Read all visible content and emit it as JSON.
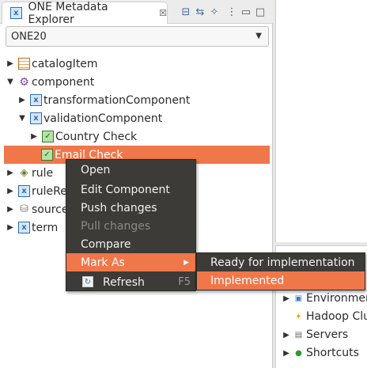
{
  "view": {
    "title": "ONE Metadata Explorer",
    "close_symbol": "☒"
  },
  "combo": {
    "value": "ONE20"
  },
  "tree": {
    "items": [
      {
        "label": "catalogItem"
      },
      {
        "label": "component"
      },
      {
        "label": "transformationComponent"
      },
      {
        "label": "validationComponent"
      },
      {
        "label": "Country Check"
      },
      {
        "label": "Email Check"
      },
      {
        "label": "rule"
      },
      {
        "label": "ruleRe"
      },
      {
        "label": "source"
      },
      {
        "label": "term"
      }
    ]
  },
  "right_panel": {
    "items": [
      {
        "label": "Environmen"
      },
      {
        "label": "Hadoop Clu"
      },
      {
        "label": "Servers"
      },
      {
        "label": "Shortcuts"
      }
    ]
  },
  "context_menu": {
    "items": [
      {
        "label": "Open"
      },
      {
        "label": "Edit Component"
      },
      {
        "label": "Push changes"
      },
      {
        "label": "Pull changes"
      },
      {
        "label": "Compare"
      },
      {
        "label": "Mark As"
      },
      {
        "label": "Refresh",
        "shortcut": "F5"
      }
    ]
  },
  "submenu": {
    "items": [
      {
        "label": "Ready for implementation"
      },
      {
        "label": "Implemented"
      }
    ]
  },
  "colors": {
    "selection": "#f0774a",
    "menu_bg": "#3c3b37"
  }
}
